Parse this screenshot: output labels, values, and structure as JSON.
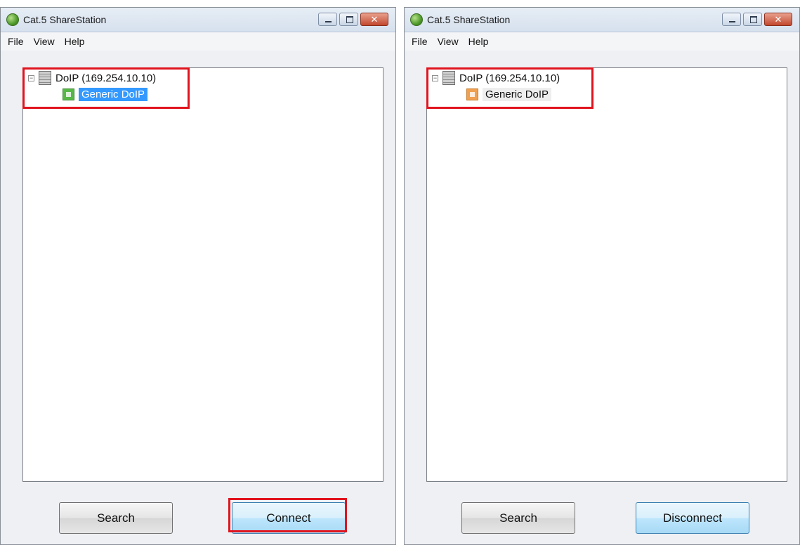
{
  "windows": [
    {
      "title": "Cat.5 ShareStation",
      "menu": [
        "File",
        "View",
        "Help"
      ],
      "tree": {
        "root_label": "DoIP (169.254.10.10)",
        "child_label": "Generic DoIP",
        "child_status": "green",
        "child_selected": true
      },
      "buttons": {
        "left": "Search",
        "right": "Connect"
      },
      "highlighted": [
        "tree",
        "right_button"
      ]
    },
    {
      "title": "Cat.5 ShareStation",
      "menu": [
        "File",
        "View",
        "Help"
      ],
      "tree": {
        "root_label": "DoIP (169.254.10.10)",
        "child_label": "Generic DoIP",
        "child_status": "orange",
        "child_selected": false
      },
      "buttons": {
        "left": "Search",
        "right": "Disconnect"
      },
      "highlighted": [
        "tree"
      ]
    }
  ],
  "colors": {
    "highlight_box": "#e0141e",
    "selection": "#3399ff",
    "status_connected_pending": "#57b847",
    "status_connected": "#f0a04e"
  },
  "icons": {
    "app": "cat5-globe-icon",
    "minimize": "minimize-icon",
    "maximize": "maximize-icon",
    "close": "close-icon",
    "server": "server-icon",
    "device": "device-icon"
  }
}
